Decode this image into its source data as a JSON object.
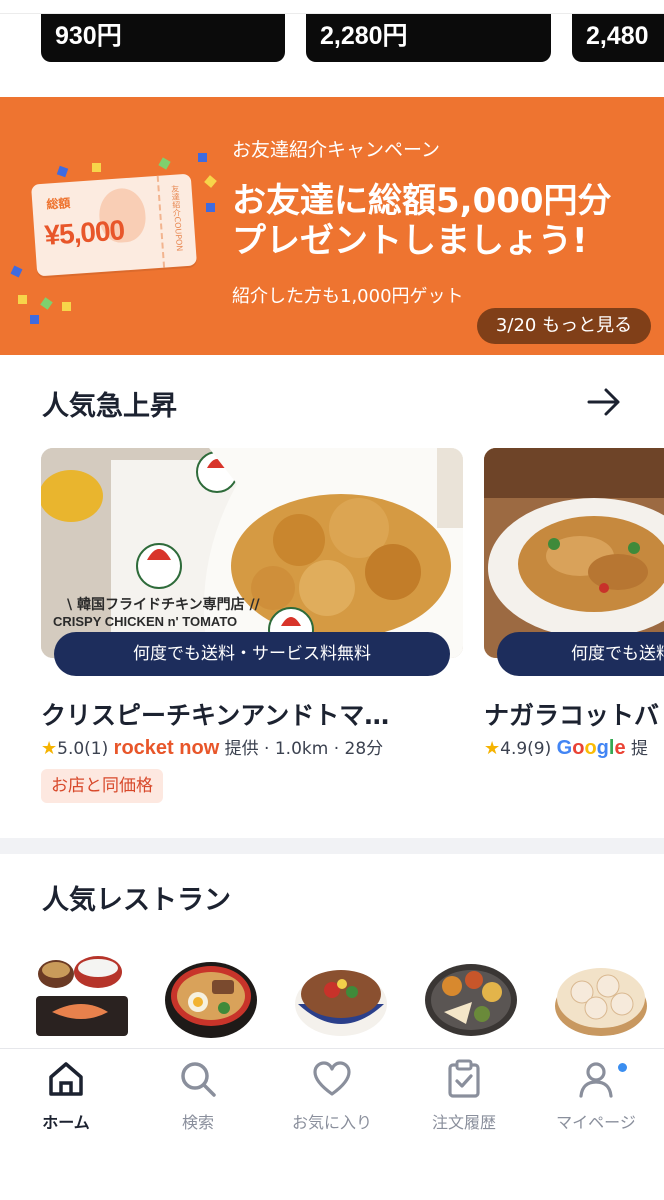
{
  "price_chips": [
    "930円",
    "2,280円",
    "2,480"
  ],
  "banner": {
    "coupon_label": "総額",
    "coupon_amount": "¥5,000",
    "coupon_stub": "友達紹介COUPON",
    "subtitle": "お友達紹介キャンペーン",
    "title_line1": "お友達に総額5,000円分",
    "title_line2": "プレゼントしましょう!",
    "note": "紹介した方も1,000円ゲット",
    "pager_more": "3/20 もっと見る",
    "color": "#ee7430"
  },
  "trending": {
    "title": "人気急上昇",
    "cards": [
      {
        "photo_caption": "\\ 韓国フライドチキン専門店 //",
        "photo_brand": "CRISPY CHICKEN n' TOMATO",
        "badge": "何度でも送料・サービス料無料",
        "name": "クリスピーチキンアンドトマ…",
        "rating": "5.0(1)",
        "provider": "rocket now",
        "meta": "提供 · 1.0km · 28分",
        "tag": "お店と同価格"
      },
      {
        "badge": "何度でも送料",
        "name": "ナガラコットバ",
        "rating": "4.9(9)",
        "provider": "Google",
        "meta": "提"
      }
    ]
  },
  "popular": {
    "title": "人気レストラン"
  },
  "nav": {
    "items": [
      {
        "label": "ホーム",
        "icon": "home-icon"
      },
      {
        "label": "検索",
        "icon": "search-icon"
      },
      {
        "label": "お気に入り",
        "icon": "heart-icon"
      },
      {
        "label": "注文履歴",
        "icon": "clipboard-check-icon"
      },
      {
        "label": "マイページ",
        "icon": "user-icon"
      }
    ],
    "active_color": "#1c2230",
    "inactive_color": "#8a8f9c",
    "notification_color": "#3b8ef0"
  }
}
